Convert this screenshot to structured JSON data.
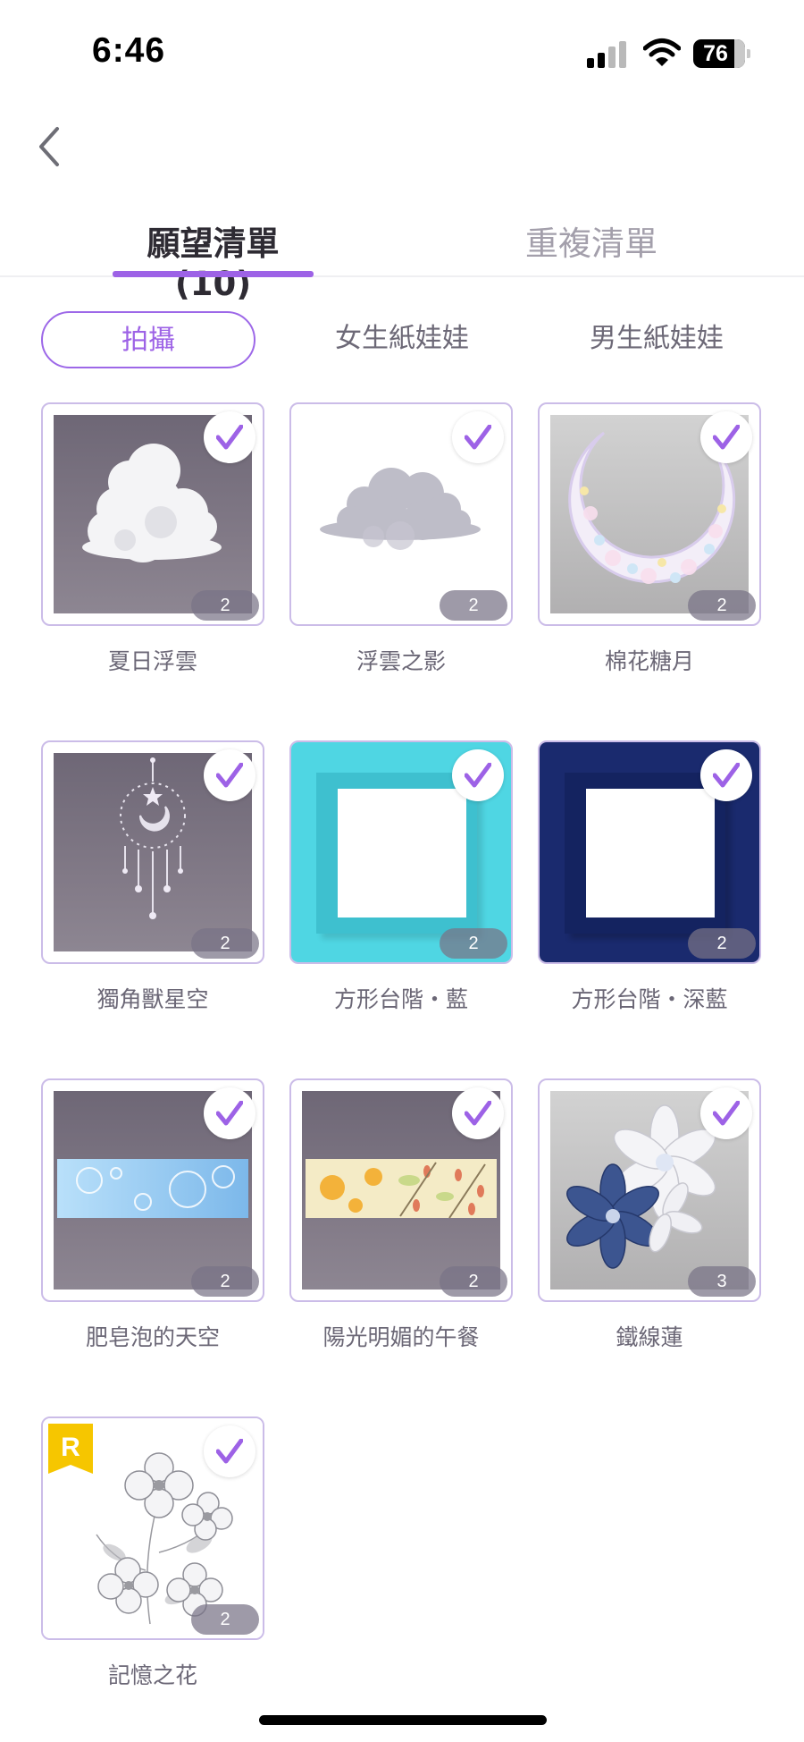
{
  "status_bar": {
    "time": "6:46",
    "battery": "76"
  },
  "tabs": [
    {
      "label": "願望清單 (10)",
      "active": true
    },
    {
      "label": "重複清單",
      "active": false
    }
  ],
  "filters": [
    {
      "label": "拍攝",
      "active": true
    },
    {
      "label": "女生紙娃娃",
      "active": false
    },
    {
      "label": "男生紙娃娃",
      "active": false
    }
  ],
  "items": [
    {
      "name": "夏日浮雲",
      "count": "2"
    },
    {
      "name": "浮雲之影",
      "count": "2"
    },
    {
      "name": "棉花糖月",
      "count": "2"
    },
    {
      "name": "獨角獸星空",
      "count": "2"
    },
    {
      "name": "方形台階・藍",
      "count": "2"
    },
    {
      "name": "方形台階・深藍",
      "count": "2"
    },
    {
      "name": "肥皂泡的天空",
      "count": "2"
    },
    {
      "name": "陽光明媚的午餐",
      "count": "2"
    },
    {
      "name": "鐵線蓮",
      "count": "3"
    },
    {
      "name": "記憶之花",
      "count": "2",
      "badge": "R"
    }
  ],
  "colors": {
    "accent": "#9d62e6",
    "card_border": "#cbbce8",
    "badge": "#f6c600"
  }
}
